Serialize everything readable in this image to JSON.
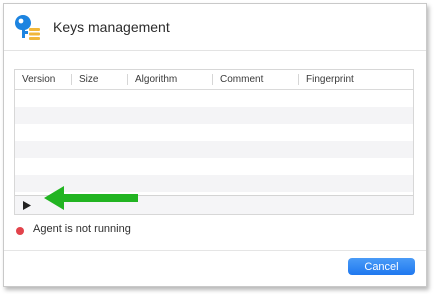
{
  "window": {
    "title": "Keys management",
    "app_icon": "key-app-icon"
  },
  "table": {
    "columns": [
      "Version",
      "Size",
      "Algorithm",
      "Comment",
      "Fingerprint"
    ],
    "rows": [],
    "expand_icon": "play-triangle-icon"
  },
  "annotation": {
    "icon": "green-arrow-left-icon",
    "color": "#22b422"
  },
  "status": {
    "text": "Agent is not running",
    "indicator_color": "#e2434b"
  },
  "footer": {
    "cancel_label": "Cancel",
    "accent_color": "#1f78ef"
  }
}
